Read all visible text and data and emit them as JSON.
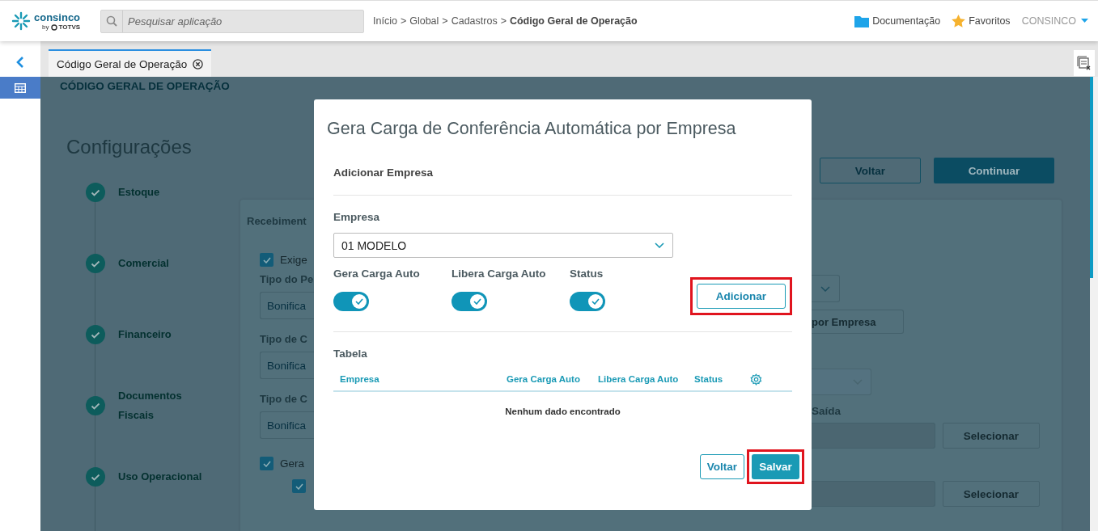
{
  "header": {
    "logo": {
      "name": "consinco",
      "by": "by",
      "brand": "TOTVS"
    },
    "search": {
      "placeholder": "Pesquisar aplicação"
    },
    "breadcrumb": [
      {
        "label": "Início",
        "sep": ">",
        "current": false
      },
      {
        "label": "Global",
        "sep": ">",
        "current": false
      },
      {
        "label": "Cadastros",
        "sep": ">",
        "current": false
      },
      {
        "label": "Código Geral de Operação",
        "current": true
      }
    ],
    "links": [
      {
        "kind": "folder",
        "label": "Documentação"
      },
      {
        "kind": "star",
        "label": "Favoritos"
      }
    ],
    "user": "CONSINCO"
  },
  "tabs": [
    {
      "label": "Código Geral de Operação",
      "selected": true
    }
  ],
  "page": {
    "heading": "CÓDIGO GERAL DE OPERAÇÃO",
    "title": "Configurações",
    "steps": [
      {
        "label": "Estoque",
        "done": true
      },
      {
        "label": "Comercial",
        "done": true
      },
      {
        "label": "Financeiro",
        "done": true
      },
      {
        "label": "Documentos Fiscais",
        "done": true
      },
      {
        "label": "Uso Operacional",
        "done": true
      }
    ],
    "buttons": [
      {
        "kind": "outline",
        "label": "Voltar"
      },
      {
        "kind": "primary",
        "label": "Continuar"
      }
    ],
    "card_left": [
      {
        "kind": "title",
        "text": "Recebiment"
      },
      {
        "kind": "checkbox",
        "text": "Exige",
        "checked": true
      },
      {
        "kind": "label",
        "text": "Tipo do Pe"
      },
      {
        "kind": "select",
        "text": "Bonifica"
      },
      {
        "kind": "label",
        "text": "Tipo de C"
      },
      {
        "kind": "select",
        "text": "Bonifica"
      },
      {
        "kind": "label",
        "text": "Tipo de C"
      },
      {
        "kind": "select",
        "text": "Bonifica"
      },
      {
        "kind": "checkbox",
        "text": "Gera",
        "checked": true
      },
      {
        "kind": "subcheckbox",
        "checked": true
      }
    ],
    "card_right": {
      "button": "por Empresa",
      "label": "Saída",
      "buttons": [
        "Selecionar",
        "Selecionar"
      ]
    }
  },
  "modal": {
    "title": "Gera Carga de Conferência Automática por Empresa",
    "section": "Adicionar Empresa",
    "empresa_label": "Empresa",
    "empresa_value": "01 MODELO",
    "toggles": [
      {
        "label": "Gera Carga Auto",
        "on": true
      },
      {
        "label": "Libera Carga Auto",
        "on": true
      },
      {
        "label": "Status",
        "on": true
      }
    ],
    "add_button": "Adicionar",
    "table": {
      "title": "Tabela",
      "columns": [
        "Empresa",
        "Gera Carga Auto",
        "Libera Carga Auto",
        "Status"
      ],
      "empty": "Nenhum dado encontrado"
    },
    "buttons": [
      {
        "kind": "outline",
        "label": "Voltar"
      },
      {
        "kind": "primary",
        "label": "Salvar"
      }
    ]
  }
}
